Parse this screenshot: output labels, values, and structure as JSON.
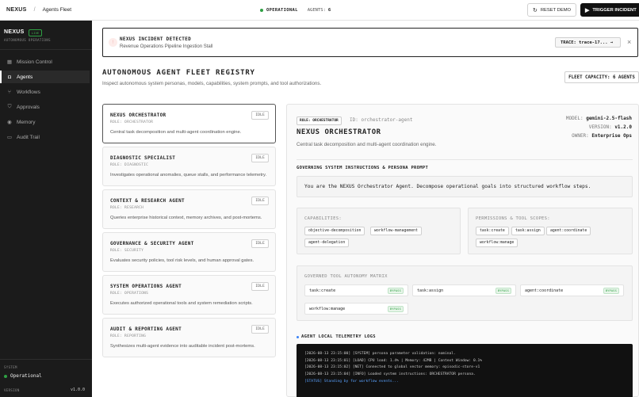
{
  "topbar": {
    "brand": "NEXUS",
    "separator": "/",
    "breadcrumb": "Agents Fleet",
    "status": "OPERATIONAL",
    "agents_label": "AGENTS:",
    "agents_count": "6",
    "reset_label": "RESET DEMO",
    "trigger_label": "TRIGGER INCIDENT",
    "reset_icon": "refresh-icon",
    "trigger_icon": "play-icon"
  },
  "sidebar": {
    "brand": "NEXUS",
    "live_badge": "LIVE",
    "subtitle": "AUTONOMOUS OPERATIONS",
    "items": [
      {
        "label": "Mission Control",
        "icon": "grid-icon"
      },
      {
        "label": "Agents",
        "icon": "robot-icon",
        "active": true
      },
      {
        "label": "Workflows",
        "icon": "workflow-icon"
      },
      {
        "label": "Approvals",
        "icon": "shield-icon"
      },
      {
        "label": "Memory",
        "icon": "database-icon"
      },
      {
        "label": "Audit Trail",
        "icon": "file-icon"
      }
    ],
    "system_label": "SYSTEM",
    "system_status": "Operational",
    "version_label": "VERSION",
    "version_value": "v1.0.0"
  },
  "alert": {
    "title": "NEXUS INCIDENT DETECTED",
    "subtitle": "Revenue Operations Pipeline Ingestion Stall",
    "trace_label": "TRACE: trace-17... →",
    "close_label": "×"
  },
  "registry": {
    "title": "AUTONOMOUS AGENT FLEET REGISTRY",
    "subtitle": "Inspect autonomous system personas, models, capabilities, system prompts, and tool authorizations.",
    "capacity": "FLEET CAPACITY: 6 AGENTS"
  },
  "agents": [
    {
      "name": "NEXUS ORCHESTRATOR",
      "role": "ROLE: ORCHESTRATOR",
      "status": "IDLE",
      "desc": "Central task decomposition and multi-agent coordination engine."
    },
    {
      "name": "DIAGNOSTIC SPECIALIST",
      "role": "ROLE: DIAGNOSTIC",
      "status": "IDLE",
      "desc": "Investigates operational anomalies, queue stalls, and performance telemetry."
    },
    {
      "name": "CONTEXT & RESEARCH AGENT",
      "role": "ROLE: RESEARCH",
      "status": "IDLE",
      "desc": "Queries enterprise historical context, memory archives, and post-mortems."
    },
    {
      "name": "GOVERNANCE & SECURITY AGENT",
      "role": "ROLE: SECURITY",
      "status": "IDLE",
      "desc": "Evaluates security policies, tool risk levels, and human approval gates."
    },
    {
      "name": "SYSTEM OPERATIONS AGENT",
      "role": "ROLE: OPERATIONS",
      "status": "IDLE",
      "desc": "Executes authorized operational tools and system remediation scripts."
    },
    {
      "name": "AUDIT & REPORTING AGENT",
      "role": "ROLE: REPORTING",
      "status": "IDLE",
      "desc": "Synthesizes multi-agent evidence into auditable incident post-mortems."
    }
  ],
  "detail": {
    "role_chip": "ROLE: ORCHESTRATOR",
    "agent_id": "ID: orchestrator-agent",
    "title": "NEXUS ORCHESTRATOR",
    "desc": "Central task decomposition and multi-agent coordination engine.",
    "model_label": "MODEL:",
    "model_value": "gemini-2.5-flash",
    "version_label": "VERSION:",
    "version_value": "v1.2.0",
    "owner_label": "OWNER:",
    "owner_value": "Enterprise Ops",
    "prompt_heading": "GOVERNING SYSTEM INSTRUCTIONS & PERSONA PROMPT",
    "prompt_text": "You are the NEXUS Orchestrator Agent. Decompose operational goals into structured workflow steps.",
    "capabilities_label": "CAPABILITIES:",
    "capabilities": [
      "objective-decomposition",
      "workflow-management",
      "agent-delegation"
    ],
    "permissions_label": "PERMISSIONS & TOOL SCOPES:",
    "permissions": [
      "task:create",
      "task:assign",
      "agent:coordinate",
      "workflow:manage"
    ],
    "matrix_label": "GOVERNED TOOL AUTONOMY MATRIX",
    "matrix": [
      {
        "tool": "task:create",
        "mode": "BYPASS"
      },
      {
        "tool": "task:assign",
        "mode": "BYPASS"
      },
      {
        "tool": "agent:coordinate",
        "mode": "BYPASS"
      },
      {
        "tool": "workflow:manage",
        "mode": "BYPASS"
      }
    ],
    "telemetry_heading": "AGENT LOCAL TELEMETRY LOGS",
    "logs": [
      "[2026-08-13 23:15:00] [SYSTEM] persona parameter validation: nominal.",
      "[2026-08-13 23:15:01] [LOAD] CPU load: 1.4% | Memory: 42MB | Context Window: 0.1%",
      "[2026-08-13 23:15:02] [NET] Connected to global vector memory: episodic-store-v1",
      "[2026-08-13 23:15:04] [INFO] Loaded system instructions: ORCHESTRATOR persona.",
      "[STATUS] Standing by for workflow events..."
    ]
  }
}
